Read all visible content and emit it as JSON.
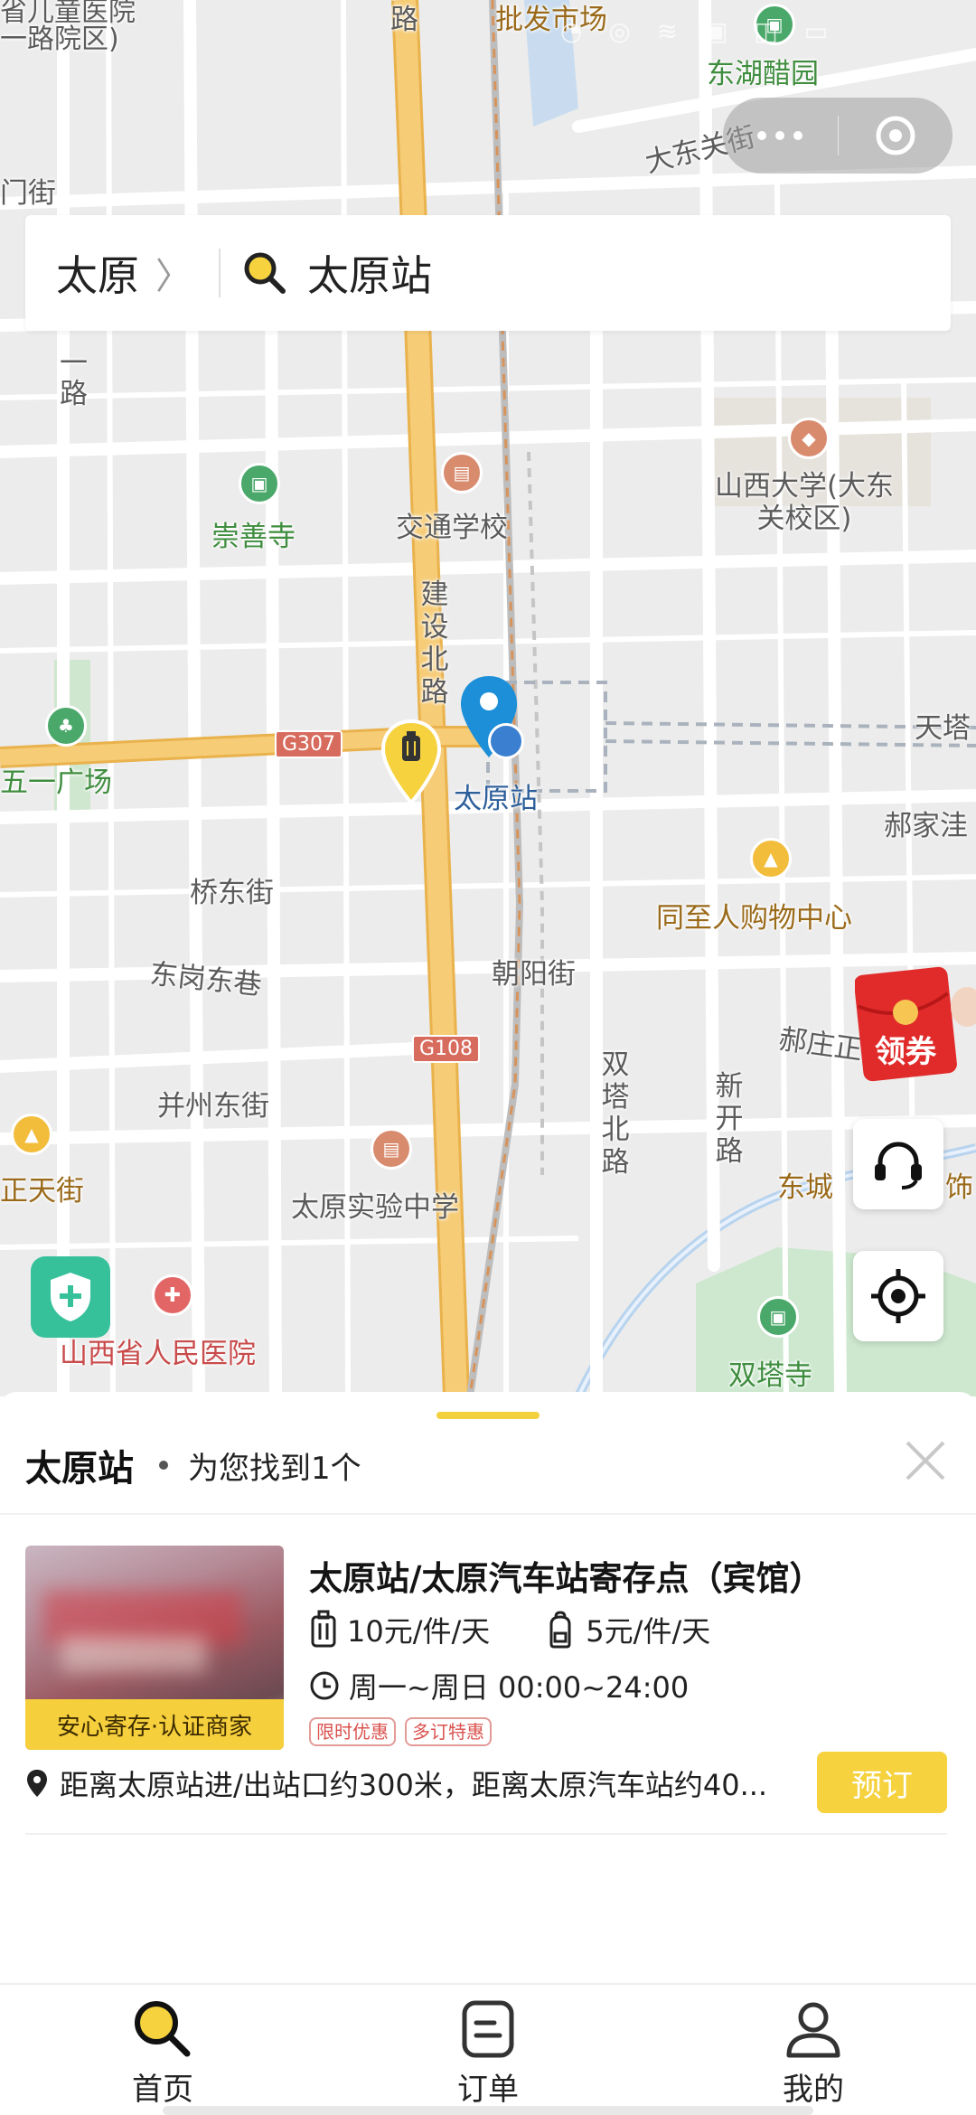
{
  "map": {
    "labels": {
      "top_left_partial": "省儿童医院",
      "top_left_partial2": "一路院区)",
      "road_lu_top": "路",
      "wholesale": "批发市场",
      "donghu": "东湖醋园",
      "dadongguan": "大东关街",
      "men_jie": "门街",
      "yi_lu_1": "一",
      "yi_lu_2": "路",
      "chongshan": "崇善寺",
      "jiaotong": "交通学校",
      "shanxi_univ": "山西大学(大东关校区)",
      "jianshe": "建设北路",
      "tianta": "天塔",
      "wuyi": "五一广场",
      "taiyuan_station": "太原站",
      "haojiawa": "郝家洼",
      "qiaodong": "桥东街",
      "tongzhiren": "同至人购物中心",
      "donggang": "东岗东巷",
      "chaoyang": "朝阳街",
      "haozhuang": "郝庄正",
      "shuangta_n": "双塔北路",
      "xinkai": "新开路",
      "bingzhou": "并州东街",
      "zhengtian": "正天街",
      "dongcheng": "东城",
      "dongcheng_tail": "饰",
      "shiyan": "太原实验中学",
      "hospital": "山西省人民医院",
      "shuangta_temple": "双塔寺",
      "shield_g307": "G307",
      "shield_g108": "G108"
    }
  },
  "header": {
    "city": "太原",
    "search_value": "太原站"
  },
  "floating": {
    "coupon_label": "领券"
  },
  "results": {
    "title": "太原站",
    "count_text": "为您找到1个"
  },
  "store": {
    "name": "太原站/太原汽车站寄存点（宾馆）",
    "badge": "安心寄存·认证商家",
    "price_large": "10元/件/天",
    "price_small": "5元/件/天",
    "hours": "周一~周日 00:00~24:00",
    "tags": [
      "限时优惠",
      "多订特惠"
    ],
    "distance": "距离太原站进/出站口约300米，距离太原汽车站约40...",
    "book_label": "预订"
  },
  "tabs": [
    {
      "label": "首页",
      "icon": "search-icon"
    },
    {
      "label": "订单",
      "icon": "order-icon"
    },
    {
      "label": "我的",
      "icon": "profile-icon"
    }
  ],
  "colors": {
    "accent_yellow": "#f5d23e",
    "map_bg": "#ececec",
    "highway": "#f2c66a",
    "pin_blue": "#1c8fd8"
  }
}
